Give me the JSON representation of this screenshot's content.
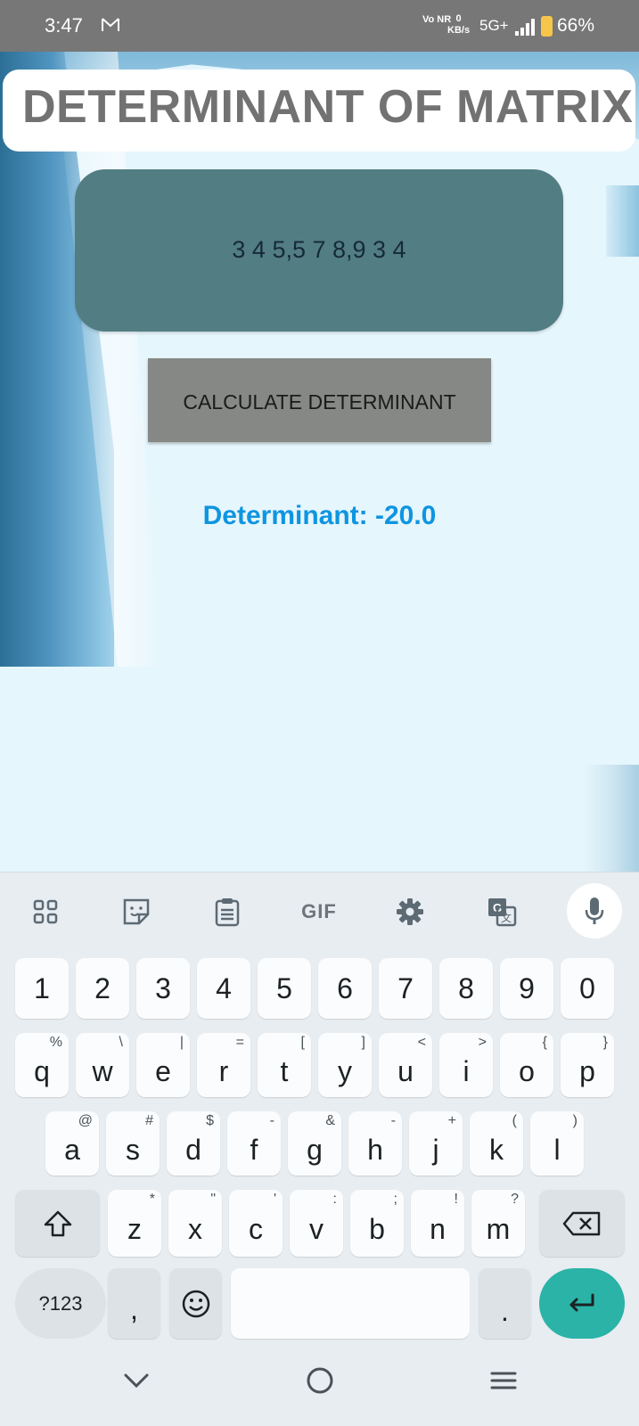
{
  "status_bar": {
    "time": "3:47",
    "volte": "Vo NR",
    "speed_value": "0",
    "speed_unit": "KB/s",
    "network": "5G+",
    "battery": "66%"
  },
  "app": {
    "title": "DETERMINANT OF MATRIX",
    "matrix_input": "3 4 5,5 7 8,9 3 4",
    "calculate_button": "CALCULATE DETERMINANT",
    "result": "Determinant: -20.0",
    "colors": {
      "input_bg": "#527e83",
      "button_bg": "#858884",
      "result": "#0e95e0",
      "title": "#727272"
    }
  },
  "keyboard": {
    "toolbar": [
      "apps-grid-icon",
      "sticker-icon",
      "clipboard-icon",
      "GIF",
      "settings-gear-icon",
      "translate-icon",
      "microphone-icon"
    ],
    "number_row": [
      "1",
      "2",
      "3",
      "4",
      "5",
      "6",
      "7",
      "8",
      "9",
      "0"
    ],
    "row1": [
      {
        "key": "q",
        "alt": "%"
      },
      {
        "key": "w",
        "alt": "\\"
      },
      {
        "key": "e",
        "alt": "|"
      },
      {
        "key": "r",
        "alt": "="
      },
      {
        "key": "t",
        "alt": "["
      },
      {
        "key": "y",
        "alt": "]"
      },
      {
        "key": "u",
        "alt": "<"
      },
      {
        "key": "i",
        "alt": ">"
      },
      {
        "key": "o",
        "alt": "{"
      },
      {
        "key": "p",
        "alt": "}"
      }
    ],
    "row2": [
      {
        "key": "a",
        "alt": "@"
      },
      {
        "key": "s",
        "alt": "#"
      },
      {
        "key": "d",
        "alt": "$"
      },
      {
        "key": "f",
        "alt": "-"
      },
      {
        "key": "g",
        "alt": "&"
      },
      {
        "key": "h",
        "alt": "-"
      },
      {
        "key": "j",
        "alt": "+"
      },
      {
        "key": "k",
        "alt": "("
      },
      {
        "key": "l",
        "alt": ")"
      }
    ],
    "row3": [
      {
        "key": "z",
        "alt": "*"
      },
      {
        "key": "x",
        "alt": "\""
      },
      {
        "key": "c",
        "alt": "'"
      },
      {
        "key": "v",
        "alt": ":"
      },
      {
        "key": "b",
        "alt": ";"
      },
      {
        "key": "n",
        "alt": "!"
      },
      {
        "key": "m",
        "alt": "?"
      }
    ],
    "symbols_key": "?123",
    "comma_key": ",",
    "period_key": ".",
    "enter_color": "#2ab3a6"
  }
}
